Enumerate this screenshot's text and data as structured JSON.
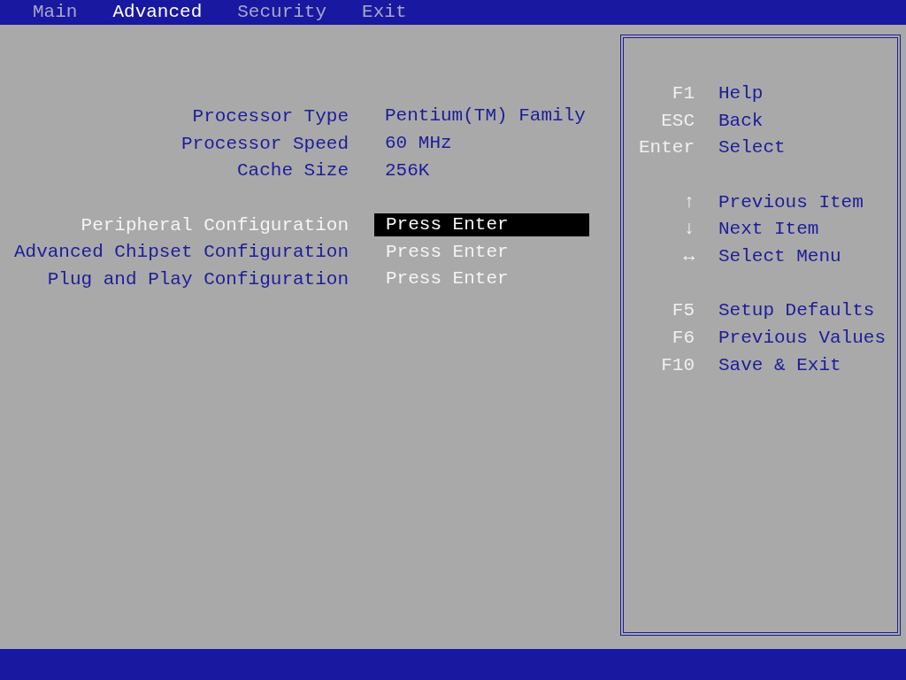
{
  "menu": [
    {
      "label": "Main",
      "selected": false
    },
    {
      "label": "Advanced",
      "selected": true
    },
    {
      "label": "Security",
      "selected": false
    },
    {
      "label": "Exit",
      "selected": false
    }
  ],
  "info_rows": [
    {
      "label": "Processor Type",
      "value": "Pentium(TM) Family"
    },
    {
      "label": "Processor Speed",
      "value": "60 MHz"
    },
    {
      "label": "Cache Size",
      "value": "256K"
    }
  ],
  "submenus": [
    {
      "label": "Peripheral Configuration",
      "value": "Press Enter",
      "selected": true
    },
    {
      "label": "Advanced Chipset Configuration",
      "value": "Press Enter",
      "selected": false
    },
    {
      "label": "Plug and Play Configuration",
      "value": "Press Enter",
      "selected": false
    }
  ],
  "help": [
    [
      {
        "key": "F1",
        "action": "Help"
      },
      {
        "key": "ESC",
        "action": "Back"
      },
      {
        "key": "Enter",
        "action": "Select"
      }
    ],
    [
      {
        "key": "↑",
        "action": "Previous Item"
      },
      {
        "key": "↓",
        "action": "Next Item"
      },
      {
        "key": "↔",
        "action": "Select Menu"
      }
    ],
    [
      {
        "key": "F5",
        "action": "Setup Defaults"
      },
      {
        "key": "F6",
        "action": "Previous Values"
      },
      {
        "key": "F10",
        "action": "Save & Exit"
      }
    ]
  ]
}
